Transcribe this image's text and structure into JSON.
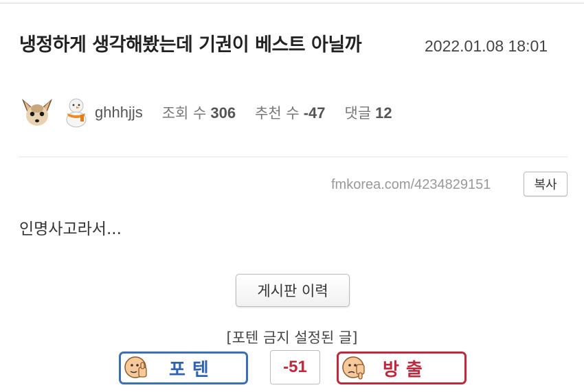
{
  "post": {
    "title": "냉정하게 생각해봤는데 기권이 베스트 아닐까",
    "date": "2022.01.08 18:01",
    "content": "인명사고라서..."
  },
  "author": {
    "nickname": "ghhhjjs",
    "avatar_icon": "chihuahua-face-icon",
    "level_icon": "snowman-level-icon"
  },
  "stats": {
    "views_label": "조회 수",
    "views": "306",
    "recommend_label": "추천 수",
    "recommend": "-47",
    "comments_label": "댓글",
    "comments": "12"
  },
  "share": {
    "url": "fmkorea.com/4234829151",
    "copy_label": "복사"
  },
  "board": {
    "history_label": "게시판 이력",
    "notice": "[포텐 금지 설정된 글]"
  },
  "vote": {
    "up_label": "포텐",
    "down_label": "방출",
    "count": "-51",
    "up_color": "#3a6fb5",
    "down_color": "#c0283b"
  }
}
